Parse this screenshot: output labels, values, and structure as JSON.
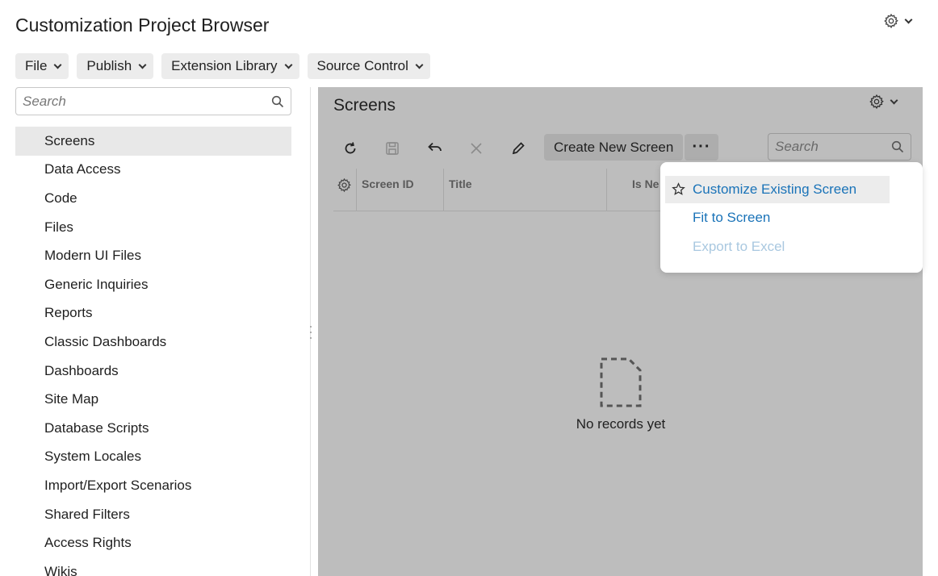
{
  "app": {
    "title": "Customization Project Browser"
  },
  "menubar": {
    "items": [
      {
        "label": "File"
      },
      {
        "label": "Publish"
      },
      {
        "label": "Extension Library"
      },
      {
        "label": "Source Control"
      }
    ]
  },
  "sidebar": {
    "search_placeholder": "Search",
    "items": [
      {
        "label": "Screens",
        "active": true
      },
      {
        "label": "Data Access"
      },
      {
        "label": "Code"
      },
      {
        "label": "Files"
      },
      {
        "label": "Modern UI Files"
      },
      {
        "label": "Generic Inquiries"
      },
      {
        "label": "Reports"
      },
      {
        "label": "Classic Dashboards"
      },
      {
        "label": "Dashboards"
      },
      {
        "label": "Site Map"
      },
      {
        "label": "Database Scripts"
      },
      {
        "label": "System Locales"
      },
      {
        "label": "Import/Export Scenarios"
      },
      {
        "label": "Shared Filters"
      },
      {
        "label": "Access Rights"
      },
      {
        "label": "Wikis"
      }
    ]
  },
  "main": {
    "title": "Screens",
    "toolbar": {
      "create_label": "Create New Screen",
      "more_label": "···",
      "search_placeholder": "Search"
    },
    "grid": {
      "columns": [
        "Screen ID",
        "Title",
        "Is Ne"
      ]
    },
    "empty_text": "No records yet"
  },
  "dropdown": {
    "items": [
      {
        "label": "Customize Existing Screen",
        "highlighted": true,
        "icon": "star-icon"
      },
      {
        "label": "Fit to Screen"
      },
      {
        "label": "Export to Excel",
        "disabled": true
      }
    ]
  },
  "colors": {
    "link": "#1a73b8",
    "link_disabled": "#a9c8e0",
    "panel_overlay": "#bdbdbd",
    "active_nav": "#e8e8e8"
  }
}
